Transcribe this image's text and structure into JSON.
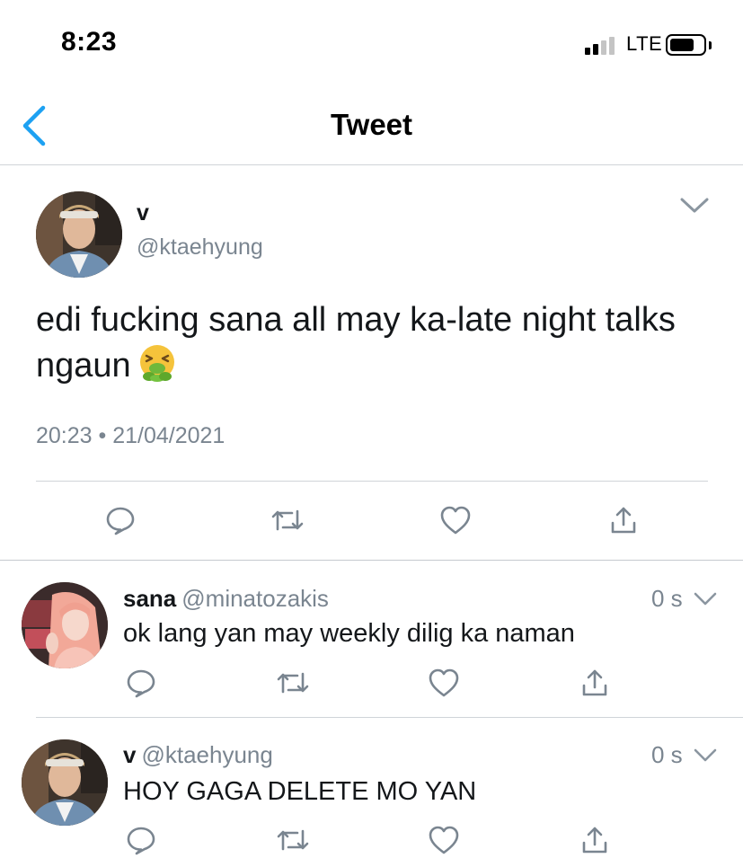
{
  "status_bar": {
    "time": "8:23",
    "network": "LTE",
    "signal_bars_filled": 2,
    "signal_bars_total": 4
  },
  "nav": {
    "title": "Tweet",
    "back_icon": "chevron-left-icon"
  },
  "main_tweet": {
    "name": "v",
    "handle": "@ktaehyung",
    "text": "edi fucking sana all may ka-late night talks ngaun",
    "emoji": "vomiting-face-emoji",
    "timestamp": "20:23 • 21/04/2021",
    "actions": [
      "reply-icon",
      "retweet-icon",
      "like-icon",
      "share-icon"
    ]
  },
  "replies": [
    {
      "name": "sana",
      "handle": "@minatozakis",
      "time": "0 s",
      "text": "ok lang yan may weekly dilig ka naman"
    },
    {
      "name": "v",
      "handle": "@ktaehyung",
      "time": "0 s",
      "text": "HOY GAGA DELETE MO YAN"
    }
  ],
  "colors": {
    "accent": "#1da1f2",
    "text_primary": "#14171a",
    "text_secondary": "#7a8590",
    "icon_gray": "#7a8590",
    "divider": "#d0d4d8"
  }
}
